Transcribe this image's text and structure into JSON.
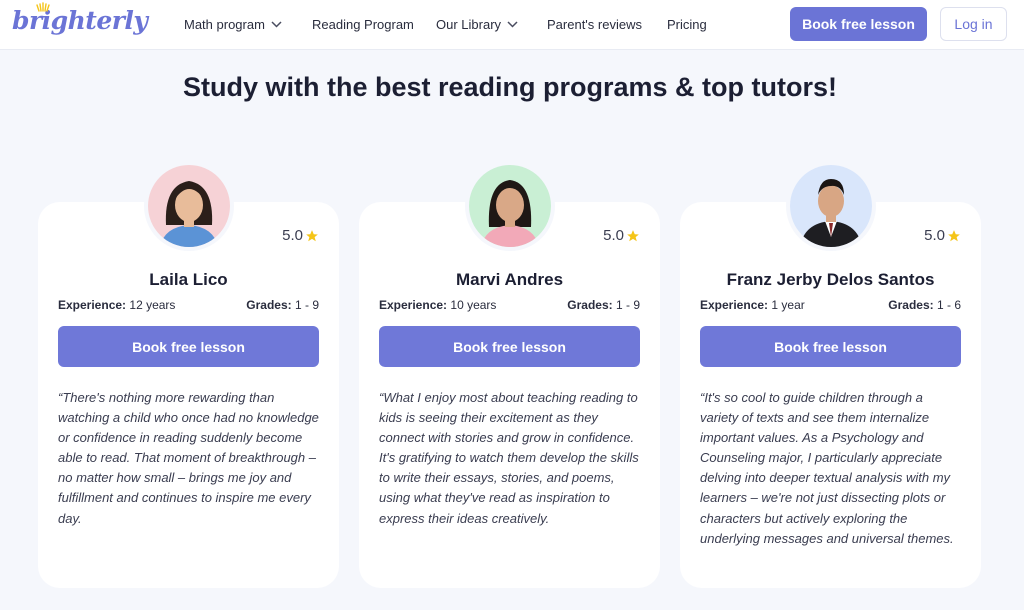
{
  "header": {
    "logo": "brighterly",
    "nav": [
      {
        "label": "Math program",
        "dropdown": true
      },
      {
        "label": "Reading Program",
        "dropdown": false
      },
      {
        "label": "Our Library",
        "dropdown": true
      },
      {
        "label": "Parent's reviews",
        "dropdown": false
      },
      {
        "label": "Pricing",
        "dropdown": false
      }
    ],
    "book_label": "Book free lesson",
    "login_label": "Log in"
  },
  "main": {
    "title": "Study with the best reading programs & top tutors!"
  },
  "tutors": [
    {
      "name": "Laila Lico",
      "rating": "5.0",
      "experience_label": "Experience:",
      "experience": "12 years",
      "grades_label": "Grades:",
      "grades": "1 - 9",
      "button": "Book free lesson",
      "quote": "“There's nothing more rewarding than watching a child who once had no knowledge or confidence in reading suddenly become able to read. That moment of breakthrough – no matter how small – brings me joy and fulfillment and continues to inspire me every day.",
      "avatar_bg": "#f6d2d6"
    },
    {
      "name": "Marvi Andres",
      "rating": "5.0",
      "experience_label": "Experience:",
      "experience": "10 years",
      "grades_label": "Grades:",
      "grades": "1 - 9",
      "button": "Book free lesson",
      "quote": "“What I enjoy most about teaching reading to kids is seeing their excitement as they connect with stories and grow in confidence. It's gratifying to watch them develop the skills to write their essays, stories, and poems, using what they've read as inspiration to express their ideas creatively.",
      "avatar_bg": "#c9efd4"
    },
    {
      "name": "Franz Jerby Delos Santos",
      "rating": "5.0",
      "experience_label": "Experience:",
      "experience": "1 year",
      "grades_label": "Grades:",
      "grades": "1 - 6",
      "button": "Book free lesson",
      "quote": "“It's so cool to guide children through a variety of texts and see them internalize important values. As a Psychology and Counseling major, I particularly appreciate delving into deeper textual analysis with my learners – we're not just dissecting plots or characters but actively exploring the underlying messages and universal themes.",
      "avatar_bg": "#d9e6fb"
    }
  ],
  "colors": {
    "accent": "#6b74d6",
    "star": "#f5c518",
    "background": "#f5f7fc"
  }
}
